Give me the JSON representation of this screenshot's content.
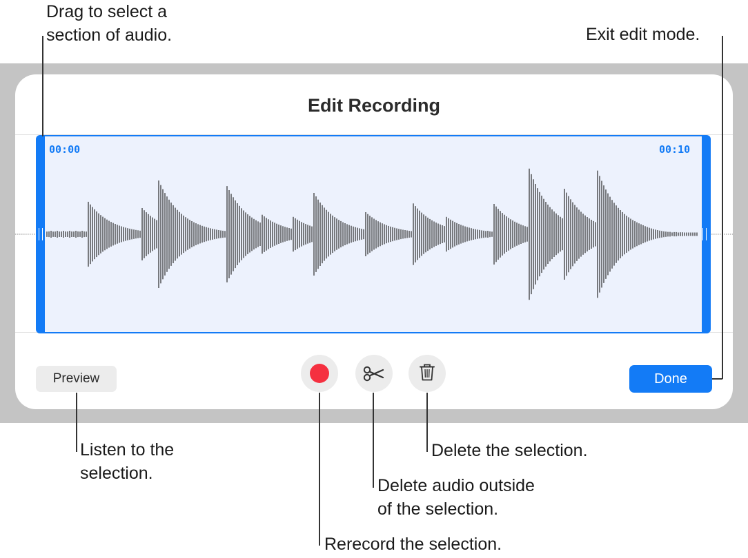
{
  "dialog": {
    "title": "Edit Recording",
    "time_start": "00:00",
    "time_end": "00:10",
    "preview_label": "Preview",
    "done_label": "Done"
  },
  "callouts": {
    "select": "Drag to select a\nsection of audio.",
    "exit": "Exit edit mode.",
    "preview": "Listen to the\nselection.",
    "delete": "Delete the selection.",
    "trim": "Delete audio outside\nof the selection.",
    "record": "Rerecord the selection."
  },
  "colors": {
    "accent": "#137bf6",
    "record": "#f53040",
    "selection_fill": "#edf2fd",
    "backdrop": "#c4c4c4"
  },
  "icons": {
    "record": "record-icon",
    "trim": "scissors-icon",
    "delete": "trash-icon"
  }
}
